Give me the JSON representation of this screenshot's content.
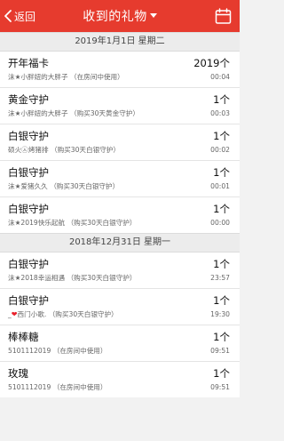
{
  "header": {
    "back_label": "返回",
    "title": "收到的礼物"
  },
  "colors": {
    "header_bg": "#e63b2e",
    "heart": "#e8202a"
  },
  "sections": [
    {
      "date": "2019年1月1日  星期二",
      "items": [
        {
          "name": "开年福卡",
          "desc": "沫★小胖妞的大胖子   （在房间中使用）",
          "count": "2019个",
          "time": "00:04"
        },
        {
          "name": "黄金守护",
          "desc": "沫★小胖妞的大胖子   （购买30天黄金守护）",
          "count": "1个",
          "time": "00:03"
        },
        {
          "name": "白银守护",
          "desc": "硕火㉦烤猪排   （购买30天白银守护）",
          "count": "1个",
          "time": "00:02"
        },
        {
          "name": "白银守护",
          "desc": "沫★爱猪久久   （购买30天白银守护）",
          "count": "1个",
          "time": "00:01"
        },
        {
          "name": "白银守护",
          "desc": "沫★2019快乐起航   （购买30天白银守护）",
          "count": "1个",
          "time": "00:00"
        }
      ]
    },
    {
      "date": "2018年12月31日  星期一",
      "items": [
        {
          "name": "白银守护",
          "desc": "沫★2018幸运相遇   （购买30天白银守护）",
          "count": "1个",
          "time": "23:57"
        },
        {
          "name": "白银守护",
          "desc_prefix": "_",
          "desc_suffix": "西门小歌.   （购买30天白银守护）",
          "count": "1个",
          "time": "19:30"
        },
        {
          "name": "棒棒糖",
          "desc": "5101112019   （在房间中使用）",
          "count": "1个",
          "time": "09:51"
        },
        {
          "name": "玫瑰",
          "desc": "5101112019   （在房间中使用）",
          "count": "1个",
          "time": "09:51"
        }
      ]
    }
  ]
}
